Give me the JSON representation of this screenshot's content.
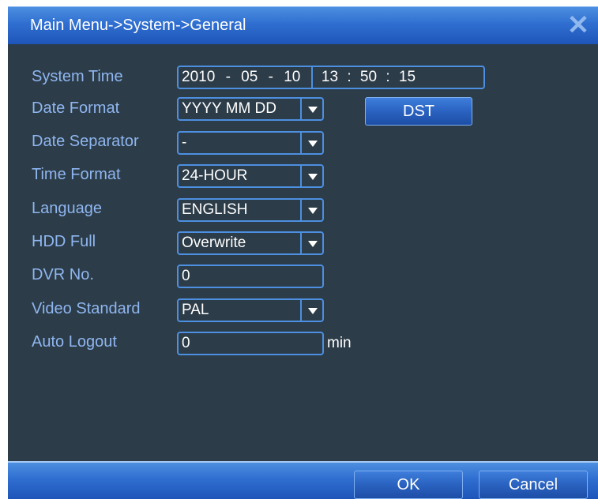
{
  "window": {
    "title": "Main Menu->System->General",
    "close_icon": "close-icon"
  },
  "settings": {
    "system_time": {
      "label": "System Time",
      "year": "2010",
      "month": "05",
      "day": "10",
      "hour": "13",
      "minute": "50",
      "second": "15",
      "date_sep": "-",
      "time_sep": ":"
    },
    "date_format": {
      "label": "Date Format",
      "value": "YYYY MM DD"
    },
    "date_separator": {
      "label": "Date Separator",
      "value": "-"
    },
    "time_format": {
      "label": "Time Format",
      "value": "24-HOUR"
    },
    "language": {
      "label": "Language",
      "value": "ENGLISH"
    },
    "hdd_full": {
      "label": "HDD Full",
      "value": "Overwrite"
    },
    "dvr_no": {
      "label": "DVR No.",
      "value": "0"
    },
    "video_standard": {
      "label": "Video Standard",
      "value": "PAL"
    },
    "auto_logout": {
      "label": "Auto Logout",
      "value": "0",
      "unit": "min"
    }
  },
  "buttons": {
    "dst": "DST",
    "ok": "OK",
    "cancel": "Cancel"
  },
  "colors": {
    "accent": "#2f6ed0",
    "panel": "#2c3c48",
    "label": "#8fb6f0"
  }
}
